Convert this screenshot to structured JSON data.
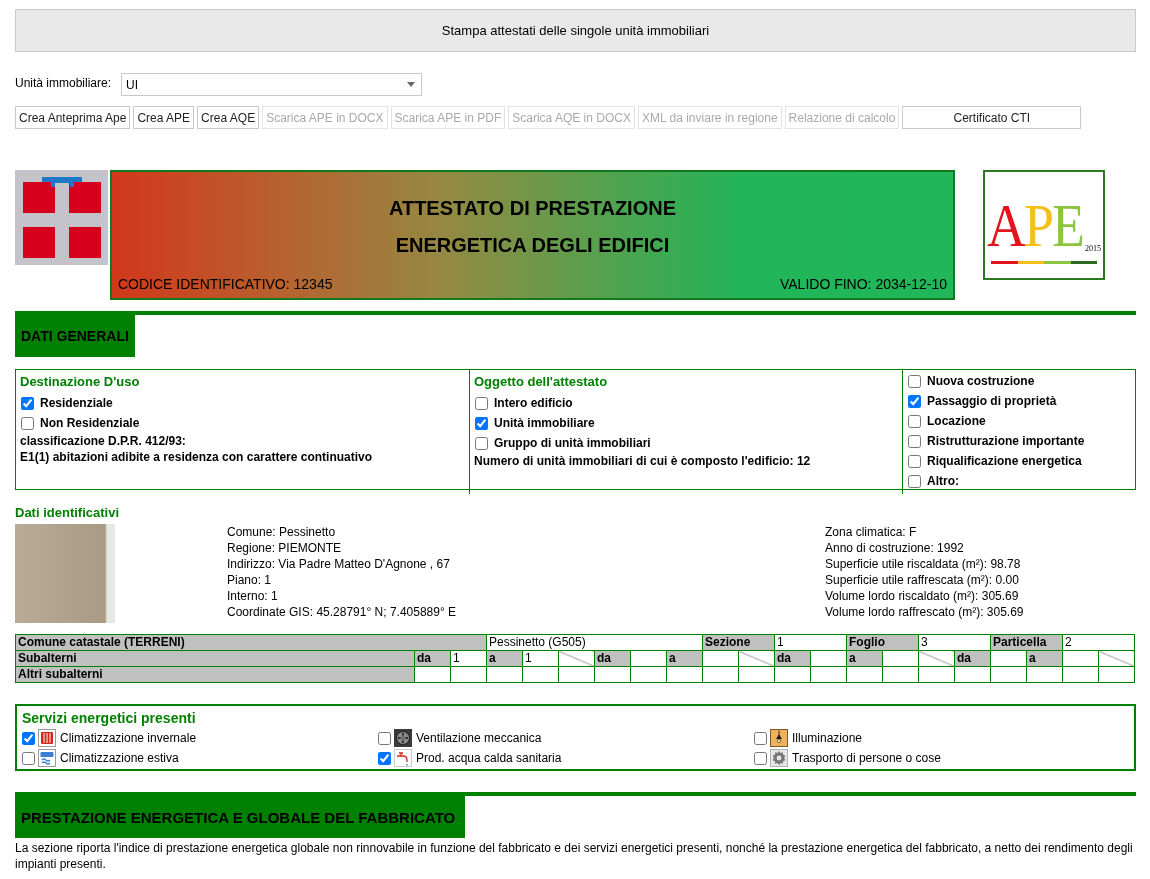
{
  "title_bar": {
    "text": "Stampa attestati delle singole unità immobiliari"
  },
  "unit_select": {
    "label": "Unità immobiliare:",
    "value": "UI"
  },
  "actions": [
    {
      "label": "Crea Anteprima Ape",
      "disabled": false
    },
    {
      "label": "Crea APE",
      "disabled": false
    },
    {
      "label": "Crea AQE",
      "disabled": false
    },
    {
      "label": "Scarica APE in DOCX",
      "disabled": true
    },
    {
      "label": "Scarica APE in PDF",
      "disabled": true
    },
    {
      "label": "Scarica AQE in DOCX",
      "disabled": true
    },
    {
      "label": "XML da inviare in regione",
      "disabled": true
    },
    {
      "label": "Relazione di calcolo",
      "disabled": true
    },
    {
      "label": "Certificato CTI",
      "disabled": false
    }
  ],
  "certificate_header": {
    "title_lines": [
      "ATTESTATO DI PRESTAZIONE",
      "ENERGETICA DEGLI EDIFICI"
    ],
    "code": "CODICE IDENTIFICATIVO: 12345",
    "valid_until": "VALIDO FINO: 2034-12-10",
    "logo": {
      "text": "APE",
      "year": "2015"
    }
  },
  "general_section": {
    "title": "DATI GENERALI",
    "columns": [
      {
        "heading": "Destinazione D'uso",
        "options": [
          {
            "label": "Residenziale",
            "checked": true
          },
          {
            "label": "Non Residenziale",
            "checked": false
          }
        ],
        "notes": [
          "classificazione D.P.R. 412/93:",
          "E1(1) abitazioni adibite a residenza con carattere continuativo"
        ]
      },
      {
        "heading": "Oggetto dell'attestato",
        "options": [
          {
            "label": "Intero edificio",
            "checked": false
          },
          {
            "label": "Unità immobiliare",
            "checked": true
          },
          {
            "label": "Gruppo di unità immobiliari",
            "checked": false
          }
        ],
        "notes": [
          "Numero di unità immobiliari di cui è composto l'edificio: 12"
        ]
      },
      {
        "options": [
          {
            "label": "Nuova costruzione",
            "checked": false
          },
          {
            "label": "Passaggio di proprietà",
            "checked": true
          },
          {
            "label": "Locazione",
            "checked": false
          },
          {
            "label": "Ristrutturazione importante",
            "checked": false
          },
          {
            "label": "Riqualificazione energetica",
            "checked": false
          },
          {
            "label": "Altro:",
            "checked": false
          }
        ]
      }
    ]
  },
  "identification": {
    "title": "Dati identificativi",
    "location": [
      "Comune: Pessinetto",
      "Regione: PIEMONTE",
      "Indirizzo: Via Padre Matteo D'Agnone , 67",
      "Piano: 1",
      "Interno: 1",
      "Coordinate GIS: 45.28791° N; 7.405889° E"
    ],
    "building": [
      "Zona climatica: F",
      "Anno di costruzione: 1992",
      "Superficie utile riscaldata (m²): 98.78",
      "Superficie utile raffrescata (m²): 0.00",
      "Volume lordo riscaldato (m²): 305.69",
      "Volume lordo raffrescato (m²): 305.69"
    ]
  },
  "cadastre": {
    "municipality_label": "Comune catastale (TERRENI)",
    "municipality": "Pessinetto (G505)",
    "parcel_fields": [
      {
        "label": "Sezione",
        "value": "1"
      },
      {
        "label": "Foglio",
        "value": "3"
      },
      {
        "label": "Particella",
        "value": "2"
      }
    ],
    "subunits": {
      "label": "Subalterni",
      "ranges": [
        {
          "from_label": "da",
          "from": "1",
          "to_label": "a",
          "to": "1"
        },
        {
          "from_label": "da",
          "to_label": "a"
        },
        {
          "from_label": "da",
          "to_label": "a"
        },
        {
          "from_label": "da",
          "to_label": "a"
        }
      ]
    },
    "other_subunits": {
      "label": "Altri subalterni"
    }
  },
  "services": {
    "title": "Servizi energetici presenti",
    "items": [
      {
        "label": "Climatizzazione invernale",
        "checked": true,
        "kind": "heating"
      },
      {
        "label": "Ventilazione meccanica",
        "checked": false,
        "kind": "ventilation"
      },
      {
        "label": "Illuminazione",
        "checked": false,
        "kind": "lighting"
      },
      {
        "label": "Climatizzazione estiva",
        "checked": false,
        "kind": "cooling"
      },
      {
        "label": "Prod. acqua calda sanitaria",
        "checked": true,
        "kind": "hot_water"
      },
      {
        "label": "Trasporto di persone o cose",
        "checked": false,
        "kind": "transport"
      }
    ]
  },
  "performance_section": {
    "title": "PRESTAZIONE ENERGETICA E GLOBALE DEL FABBRICATO",
    "description": "La sezione riporta l'indice di prestazione energetica globale non rinnovabile in funzione del fabbricato e dei servizi energetici presenti, nonché la prestazione energetica del fabbricato, a netto dei rendimento degli impianti presenti."
  }
}
